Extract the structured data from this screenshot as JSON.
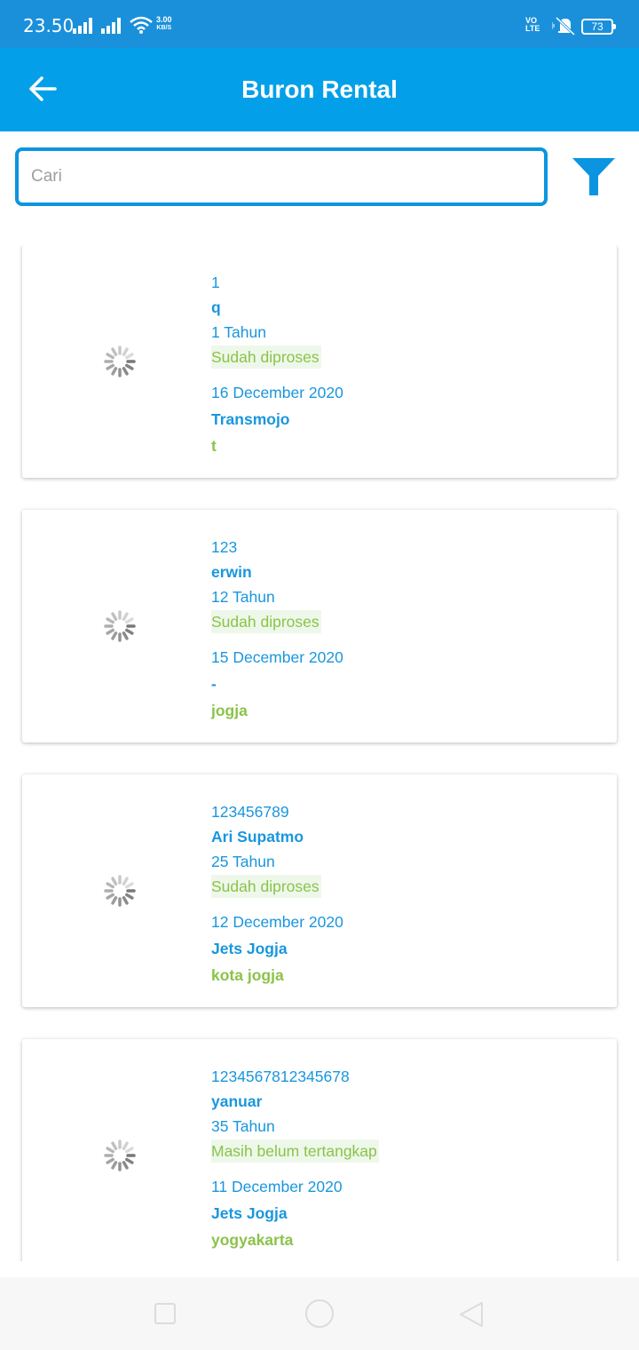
{
  "status_bar": {
    "time": "23.50",
    "net_speed_value": "3.00",
    "net_speed_unit": "KB/S",
    "volte_top": "VO",
    "volte_bottom": "LTE",
    "battery": "73",
    "icons": [
      "signal-icon",
      "signal-icon",
      "wifi-icon",
      "volte-icon",
      "mute-icon",
      "battery-icon"
    ]
  },
  "app_bar": {
    "title": "Buron Rental",
    "back_icon": "arrow-left-icon",
    "color": "#03a0e9"
  },
  "search": {
    "placeholder": "Cari",
    "value": "",
    "filter_icon": "filter-icon",
    "border_color": "#0b95e0"
  },
  "colors": {
    "primary": "#1a96dd",
    "accent_green": "#8bc34a",
    "status_bg": "#eef8ea"
  },
  "items": [
    {
      "id": "1",
      "name": "q",
      "age": "1 Tahun",
      "status": "Sudah diproses",
      "date": "16 December 2020",
      "rental": "Transmojo",
      "location": "t"
    },
    {
      "id": "123",
      "name": "erwin",
      "age": "12 Tahun",
      "status": "Sudah diproses",
      "date": "15 December 2020",
      "rental": "-",
      "location": "jogja"
    },
    {
      "id": "123456789",
      "name": "Ari Supatmo",
      "age": "25 Tahun",
      "status": "Sudah diproses",
      "date": "12 December 2020",
      "rental": "Jets Jogja",
      "location": "kota jogja"
    },
    {
      "id": "1234567812345678",
      "name": "yanuar",
      "age": "35 Tahun",
      "status": "Masih belum tertangkap",
      "date": "11 December 2020",
      "rental": "Jets Jogja",
      "location": "yogyakarta"
    }
  ],
  "nav_bar": {
    "icons": [
      "recents-square-icon",
      "home-circle-icon",
      "back-triangle-icon"
    ]
  }
}
